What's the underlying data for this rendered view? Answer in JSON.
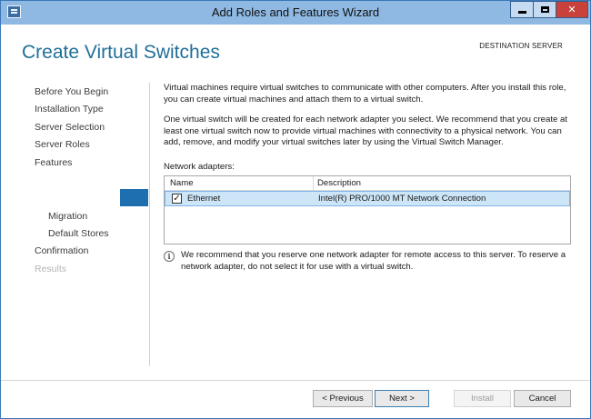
{
  "window": {
    "title": "Add Roles and Features Wizard"
  },
  "header": {
    "page_title": "Create Virtual Switches",
    "destination": "DESTINATION SERVER"
  },
  "nav": {
    "items": [
      {
        "label": "Before You Begin"
      },
      {
        "label": "Installation Type"
      },
      {
        "label": "Server Selection"
      },
      {
        "label": "Server Roles"
      },
      {
        "label": "Features"
      },
      {
        "label": "Migration"
      },
      {
        "label": "Default Stores"
      },
      {
        "label": "Confirmation"
      },
      {
        "label": "Results"
      }
    ]
  },
  "content": {
    "paragraph1": "Virtual machines require virtual switches to communicate with other computers. After you install this role, you can create virtual machines and attach them to a virtual switch.",
    "paragraph2": "One virtual switch will be created for each network adapter you select. We recommend that you create at least one virtual switch now to provide virtual machines with connectivity to a physical network. You can add, remove, and modify your virtual switches later by using the Virtual Switch Manager.",
    "adapters_label": "Network adapters:",
    "table": {
      "columns": [
        "Name",
        "Description"
      ],
      "rows": [
        {
          "name": "Ethernet",
          "description": "Intel(R) PRO/1000 MT Network Connection",
          "checked": true
        }
      ]
    },
    "info": "We recommend that you reserve one network adapter for remote access to this server. To reserve a network adapter, do not select it for use with a virtual switch."
  },
  "footer": {
    "previous": "< Previous",
    "next": "Next >",
    "install": "Install",
    "cancel": "Cancel"
  },
  "colors": {
    "title_bar": "#8fb9e2",
    "accent": "#1e6fb0",
    "page_title": "#1f6f98",
    "selected_row": "#cde6f7"
  }
}
